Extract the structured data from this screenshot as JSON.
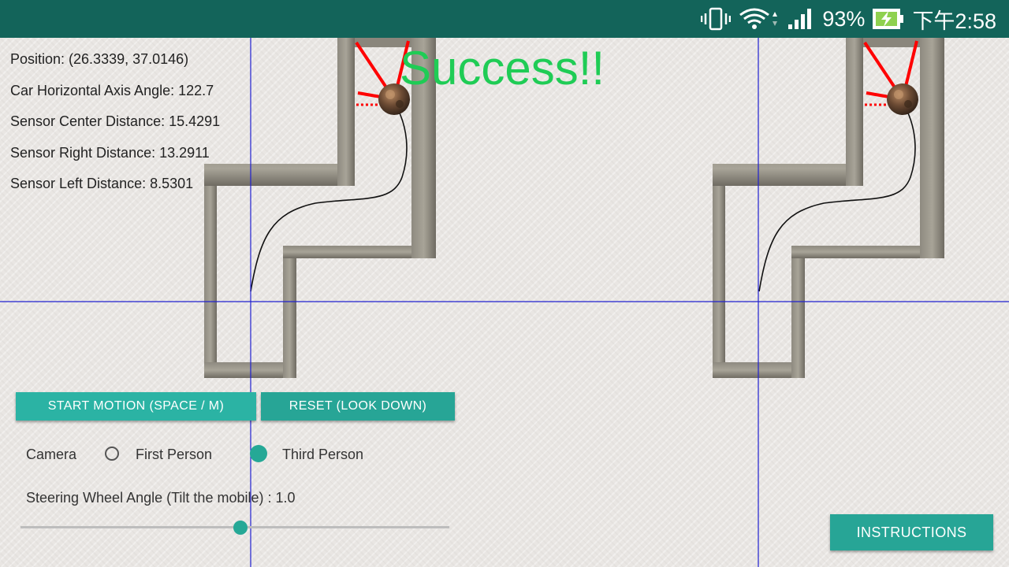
{
  "status_bar": {
    "battery_percent": "93%",
    "time": "下午2:58",
    "background_color": "#13645a",
    "icons": [
      "vibrate-icon",
      "wifi-icon",
      "signal-icon",
      "battery-charging-icon"
    ]
  },
  "telemetry": {
    "position": "Position: (26.3339, 37.0146)",
    "angle": "Car Horizontal Axis Angle: 122.7",
    "center": "Sensor Center Distance: 15.4291",
    "right": "Sensor Right Distance: 13.2911",
    "left": "Sensor Left Distance: 8.5301"
  },
  "success_message": "Success!!",
  "buttons": {
    "start": "START MOTION (SPACE / M)",
    "reset": "RESET (LOOK DOWN)",
    "instructions": "INSTRUCTIONS"
  },
  "camera": {
    "label": "Camera",
    "options": [
      "First Person",
      "Third Person"
    ],
    "selected": "Third Person"
  },
  "steering": {
    "label": "Steering Wheel Angle (Tilt the mobile) : 1.0",
    "slider_fraction": 0.51
  },
  "colors": {
    "accent": "#2bb3a4",
    "success": "#1fcc55",
    "sensor_rays": "#ff0000",
    "axis_lines": "#2020d0"
  }
}
